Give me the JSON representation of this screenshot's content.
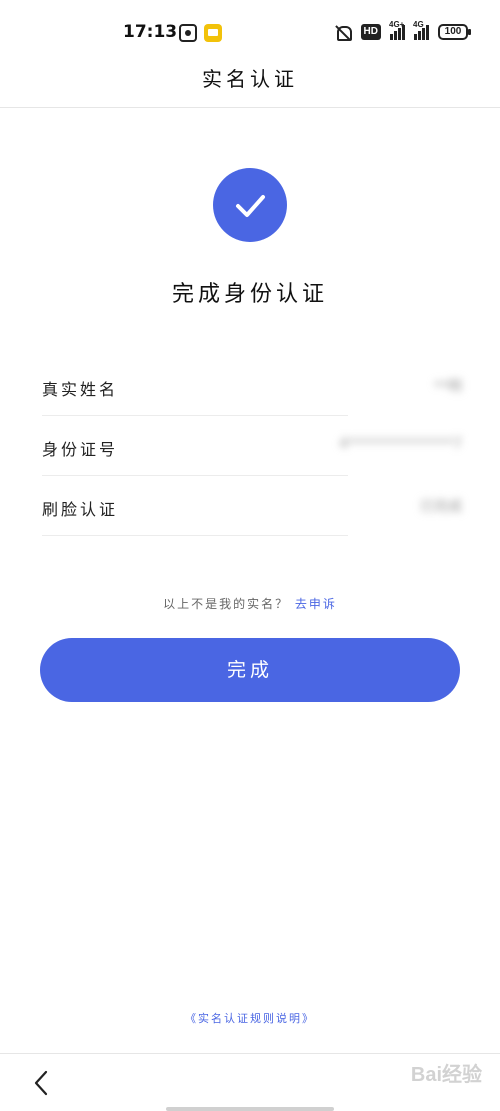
{
  "status_bar": {
    "time": "17:13",
    "hd_badge": "HD",
    "signal1_label": "4G+",
    "signal2_label": "4G",
    "battery": "100"
  },
  "header": {
    "title": "实名认证"
  },
  "success": {
    "message": "完成身份认证",
    "icon": "check-icon",
    "accent_color": "#4a66e3"
  },
  "info": {
    "rows": [
      {
        "label": "真实姓名",
        "value": "**明"
      },
      {
        "label": "身份证号",
        "value": "4***************7"
      },
      {
        "label": "刷脸认证",
        "value": "已完成"
      }
    ]
  },
  "appeal": {
    "text": "以上不是我的实名？",
    "link": "去申诉"
  },
  "done_button": {
    "label": "完成"
  },
  "rules_link": {
    "label": "《实名认证规则说明》"
  },
  "nav": {
    "back_icon": "chevron-left-icon"
  },
  "watermark": {
    "text": "Bai经验"
  }
}
